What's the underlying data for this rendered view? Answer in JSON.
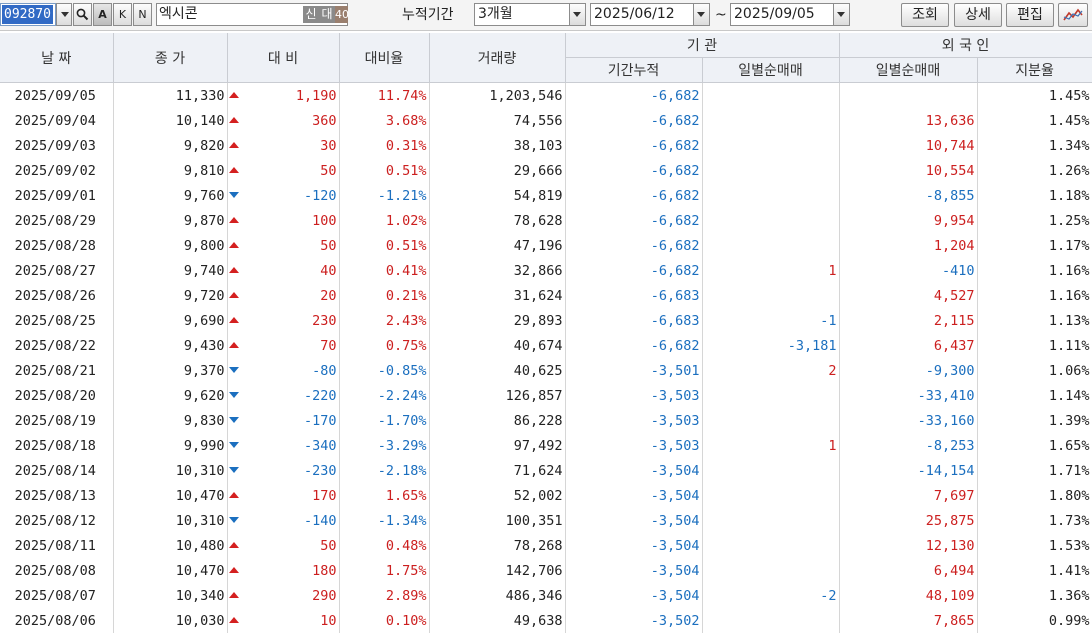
{
  "toolbar": {
    "code": "092870",
    "btn_a": "A",
    "btn_k": "K",
    "btn_n": "N",
    "name": "엑시콘",
    "badges": [
      "신",
      "대",
      "40"
    ],
    "badge_colors": [
      "#8a8a8a",
      "#8a8a8a",
      "#9a7f6e"
    ],
    "period_label": "누적기간",
    "period_value": "3개월",
    "start_date": "2025/06/12",
    "tilde": "~",
    "end_date": "2025/09/05",
    "query_label": "조회",
    "detail_label": "상세",
    "edit_label": "편집",
    "chart_icon": "chart-icon"
  },
  "headers": {
    "date": "날 짜",
    "close": "종 가",
    "change": "대 비",
    "change_rate": "대비율",
    "volume": "거래량",
    "institution": "기 관",
    "inst_cum": "기간누적",
    "inst_daily": "일별순매매",
    "foreign": "외 국 인",
    "foreign_daily": "일별순매매",
    "foreign_share": "지분율"
  },
  "colors": {
    "up": "#cc1f1f",
    "down": "#1b6fbf",
    "header_bg": "#eef1f6"
  },
  "rows": [
    {
      "date": "2025/09/05",
      "close": "11,330",
      "dir": "up",
      "chg": "1,190",
      "rate": "11.74%",
      "vol": "1,203,546",
      "cum": "-6,682",
      "inst": "",
      "frn": "",
      "share": "1.45%"
    },
    {
      "date": "2025/09/04",
      "close": "10,140",
      "dir": "up",
      "chg": "360",
      "rate": "3.68%",
      "vol": "74,556",
      "cum": "-6,682",
      "inst": "",
      "frn": "13,636",
      "share": "1.45%"
    },
    {
      "date": "2025/09/03",
      "close": "9,820",
      "dir": "up",
      "chg": "30",
      "rate": "0.31%",
      "vol": "38,103",
      "cum": "-6,682",
      "inst": "",
      "frn": "10,744",
      "share": "1.34%"
    },
    {
      "date": "2025/09/02",
      "close": "9,810",
      "dir": "up",
      "chg": "50",
      "rate": "0.51%",
      "vol": "29,666",
      "cum": "-6,682",
      "inst": "",
      "frn": "10,554",
      "share": "1.26%"
    },
    {
      "date": "2025/09/01",
      "close": "9,760",
      "dir": "down",
      "chg": "-120",
      "rate": "-1.21%",
      "vol": "54,819",
      "cum": "-6,682",
      "inst": "",
      "frn": "-8,855",
      "share": "1.18%"
    },
    {
      "date": "2025/08/29",
      "close": "9,870",
      "dir": "up",
      "chg": "100",
      "rate": "1.02%",
      "vol": "78,628",
      "cum": "-6,682",
      "inst": "",
      "frn": "9,954",
      "share": "1.25%"
    },
    {
      "date": "2025/08/28",
      "close": "9,800",
      "dir": "up",
      "chg": "50",
      "rate": "0.51%",
      "vol": "47,196",
      "cum": "-6,682",
      "inst": "",
      "frn": "1,204",
      "share": "1.17%"
    },
    {
      "date": "2025/08/27",
      "close": "9,740",
      "dir": "up",
      "chg": "40",
      "rate": "0.41%",
      "vol": "32,866",
      "cum": "-6,682",
      "inst": "1",
      "frn": "-410",
      "share": "1.16%"
    },
    {
      "date": "2025/08/26",
      "close": "9,720",
      "dir": "up",
      "chg": "20",
      "rate": "0.21%",
      "vol": "31,624",
      "cum": "-6,683",
      "inst": "",
      "frn": "4,527",
      "share": "1.16%"
    },
    {
      "date": "2025/08/25",
      "close": "9,690",
      "dir": "up",
      "chg": "230",
      "rate": "2.43%",
      "vol": "29,893",
      "cum": "-6,683",
      "inst": "-1",
      "frn": "2,115",
      "share": "1.13%"
    },
    {
      "date": "2025/08/22",
      "close": "9,430",
      "dir": "up",
      "chg": "70",
      "rate": "0.75%",
      "vol": "40,674",
      "cum": "-6,682",
      "inst": "-3,181",
      "frn": "6,437",
      "share": "1.11%"
    },
    {
      "date": "2025/08/21",
      "close": "9,370",
      "dir": "down",
      "chg": "-80",
      "rate": "-0.85%",
      "vol": "40,625",
      "cum": "-3,501",
      "inst": "2",
      "frn": "-9,300",
      "share": "1.06%"
    },
    {
      "date": "2025/08/20",
      "close": "9,620",
      "dir": "down",
      "chg": "-220",
      "rate": "-2.24%",
      "vol": "126,857",
      "cum": "-3,503",
      "inst": "",
      "frn": "-33,410",
      "share": "1.14%"
    },
    {
      "date": "2025/08/19",
      "close": "9,830",
      "dir": "down",
      "chg": "-170",
      "rate": "-1.70%",
      "vol": "86,228",
      "cum": "-3,503",
      "inst": "",
      "frn": "-33,160",
      "share": "1.39%"
    },
    {
      "date": "2025/08/18",
      "close": "9,990",
      "dir": "down",
      "chg": "-340",
      "rate": "-3.29%",
      "vol": "97,492",
      "cum": "-3,503",
      "inst": "1",
      "frn": "-8,253",
      "share": "1.65%"
    },
    {
      "date": "2025/08/14",
      "close": "10,310",
      "dir": "down",
      "chg": "-230",
      "rate": "-2.18%",
      "vol": "71,624",
      "cum": "-3,504",
      "inst": "",
      "frn": "-14,154",
      "share": "1.71%"
    },
    {
      "date": "2025/08/13",
      "close": "10,470",
      "dir": "up",
      "chg": "170",
      "rate": "1.65%",
      "vol": "52,002",
      "cum": "-3,504",
      "inst": "",
      "frn": "7,697",
      "share": "1.80%"
    },
    {
      "date": "2025/08/12",
      "close": "10,310",
      "dir": "down",
      "chg": "-140",
      "rate": "-1.34%",
      "vol": "100,351",
      "cum": "-3,504",
      "inst": "",
      "frn": "25,875",
      "share": "1.73%"
    },
    {
      "date": "2025/08/11",
      "close": "10,480",
      "dir": "up",
      "chg": "50",
      "rate": "0.48%",
      "vol": "78,268",
      "cum": "-3,504",
      "inst": "",
      "frn": "12,130",
      "share": "1.53%"
    },
    {
      "date": "2025/08/08",
      "close": "10,470",
      "dir": "up",
      "chg": "180",
      "rate": "1.75%",
      "vol": "142,706",
      "cum": "-3,504",
      "inst": "",
      "frn": "6,494",
      "share": "1.41%"
    },
    {
      "date": "2025/08/07",
      "close": "10,340",
      "dir": "up",
      "chg": "290",
      "rate": "2.89%",
      "vol": "486,346",
      "cum": "-3,504",
      "inst": "-2",
      "frn": "48,109",
      "share": "1.36%"
    },
    {
      "date": "2025/08/06",
      "close": "10,030",
      "dir": "up",
      "chg": "10",
      "rate": "0.10%",
      "vol": "49,638",
      "cum": "-3,502",
      "inst": "",
      "frn": "7,865",
      "share": "0.99%"
    }
  ]
}
